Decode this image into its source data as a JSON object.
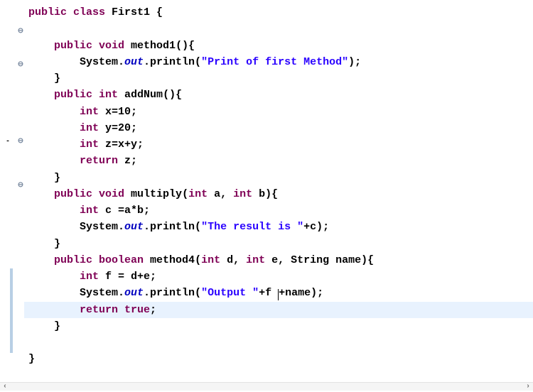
{
  "language": "java",
  "highlighted_line_index": 18,
  "fold_markers": {
    "2": "⊖",
    "5": "⊖",
    "12": "⊖",
    "16": "⊖"
  },
  "gutter": {
    "minus_row": 12
  },
  "colors": {
    "keyword": "#7f0055",
    "string": "#2a00ff",
    "static_field": "#0000c0",
    "highlight_bg": "#e8f2fe",
    "change_marker": "#b8cfe5"
  },
  "tokens": [
    [
      [
        "kw",
        "public "
      ],
      [
        "kw",
        "class "
      ],
      [
        "class",
        "First1 "
      ],
      [
        "plain",
        "{"
      ]
    ],
    [
      [
        "plain",
        ""
      ]
    ],
    [
      [
        "plain",
        "    "
      ],
      [
        "kw",
        "public "
      ],
      [
        "kw",
        "void "
      ],
      [
        "method",
        "method1"
      ],
      [
        "plain",
        "(){"
      ]
    ],
    [
      [
        "plain",
        "        "
      ],
      [
        "plain",
        "System."
      ],
      [
        "field",
        "out"
      ],
      [
        "plain",
        ".println("
      ],
      [
        "str",
        "\"Print of first Method\""
      ],
      [
        "plain",
        ");"
      ]
    ],
    [
      [
        "plain",
        "    }"
      ]
    ],
    [
      [
        "plain",
        "    "
      ],
      [
        "kw",
        "public "
      ],
      [
        "kw",
        "int "
      ],
      [
        "method",
        "addNum"
      ],
      [
        "plain",
        "(){"
      ]
    ],
    [
      [
        "plain",
        "        "
      ],
      [
        "kw",
        "int "
      ],
      [
        "plain",
        "x=10;"
      ]
    ],
    [
      [
        "plain",
        "        "
      ],
      [
        "kw",
        "int "
      ],
      [
        "plain",
        "y=20;"
      ]
    ],
    [
      [
        "plain",
        "        "
      ],
      [
        "kw",
        "int "
      ],
      [
        "plain",
        "z=x+y;"
      ]
    ],
    [
      [
        "plain",
        "        "
      ],
      [
        "kw",
        "return "
      ],
      [
        "plain",
        "z;"
      ]
    ],
    [
      [
        "plain",
        "    }"
      ]
    ],
    [
      [
        "plain",
        "    "
      ],
      [
        "kw",
        "public "
      ],
      [
        "kw",
        "void "
      ],
      [
        "method",
        "multiply"
      ],
      [
        "plain",
        "("
      ],
      [
        "kw",
        "int "
      ],
      [
        "plain",
        "a, "
      ],
      [
        "kw",
        "int "
      ],
      [
        "plain",
        "b){"
      ]
    ],
    [
      [
        "plain",
        "        "
      ],
      [
        "kw",
        "int "
      ],
      [
        "plain",
        "c =a*b;"
      ]
    ],
    [
      [
        "plain",
        "        "
      ],
      [
        "plain",
        "System."
      ],
      [
        "field",
        "out"
      ],
      [
        "plain",
        ".println("
      ],
      [
        "str",
        "\"The result is \""
      ],
      [
        "plain",
        "+c);"
      ]
    ],
    [
      [
        "plain",
        "    }"
      ]
    ],
    [
      [
        "plain",
        "    "
      ],
      [
        "kw",
        "public "
      ],
      [
        "kw",
        "boolean "
      ],
      [
        "method",
        "method4"
      ],
      [
        "plain",
        "("
      ],
      [
        "kw",
        "int "
      ],
      [
        "plain",
        "d, "
      ],
      [
        "kw",
        "int "
      ],
      [
        "plain",
        "e, String name){"
      ]
    ],
    [
      [
        "plain",
        "        "
      ],
      [
        "kw",
        "int "
      ],
      [
        "plain",
        "f = d+e;"
      ]
    ],
    [
      [
        "plain",
        "        "
      ],
      [
        "plain",
        "System."
      ],
      [
        "field",
        "out"
      ],
      [
        "plain",
        ".println("
      ],
      [
        "str",
        "\"Output \""
      ],
      [
        "plain",
        "+f "
      ],
      [
        "cursor",
        ""
      ],
      [
        "plain",
        "+name);"
      ]
    ],
    [
      [
        "plain",
        "        "
      ],
      [
        "kw",
        "return "
      ],
      [
        "kw",
        "true"
      ],
      [
        "plain",
        ";"
      ]
    ],
    [
      [
        "plain",
        "    }"
      ]
    ],
    [
      [
        "plain",
        ""
      ]
    ],
    [
      [
        "plain",
        "}"
      ]
    ]
  ],
  "scrollbar": {
    "left_arrow": "‹",
    "right_arrow": "›"
  }
}
